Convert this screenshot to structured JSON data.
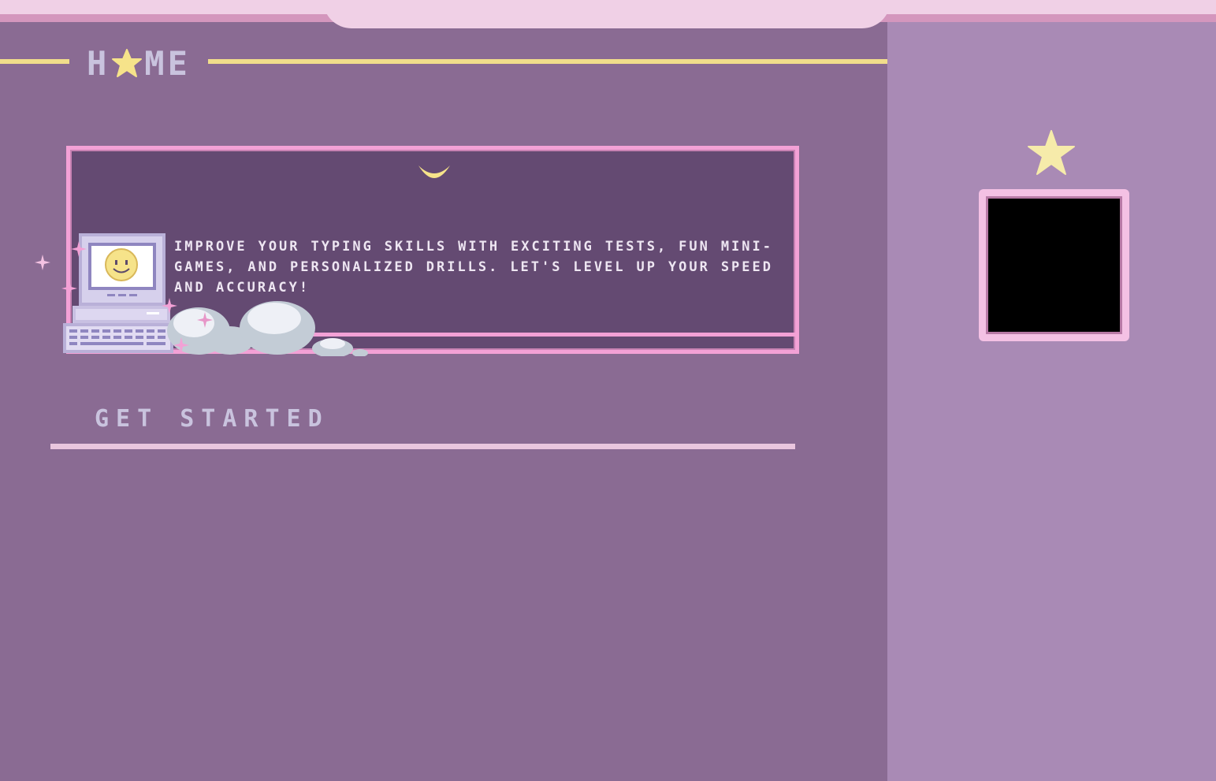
{
  "header": {
    "home_title_prefix": "H",
    "home_title_suffix": "ME"
  },
  "intro": {
    "text": "IMPROVE YOUR TYPING SKILLS WITH EXCITING TESTS, FUN MINI-GAMES, AND PERSONALIZED DRILLS. LET'S LEVEL UP YOUR SPEED AND ACCURACY!"
  },
  "section": {
    "get_started": "GET STARTED"
  },
  "icons": {
    "home_star": "star-icon",
    "moon": "moon-icon",
    "computer": "computer-icon",
    "sidebar_star": "star-icon"
  },
  "colors": {
    "main_bg": "#8a6b93",
    "sidebar_bg": "#a98ab5",
    "topbar": "#f0d0e6",
    "accent_yellow": "#f1dd8b",
    "panel_bg": "#644a72",
    "panel_border": "#f3a1d6",
    "heading_text": "#c9c3de"
  }
}
